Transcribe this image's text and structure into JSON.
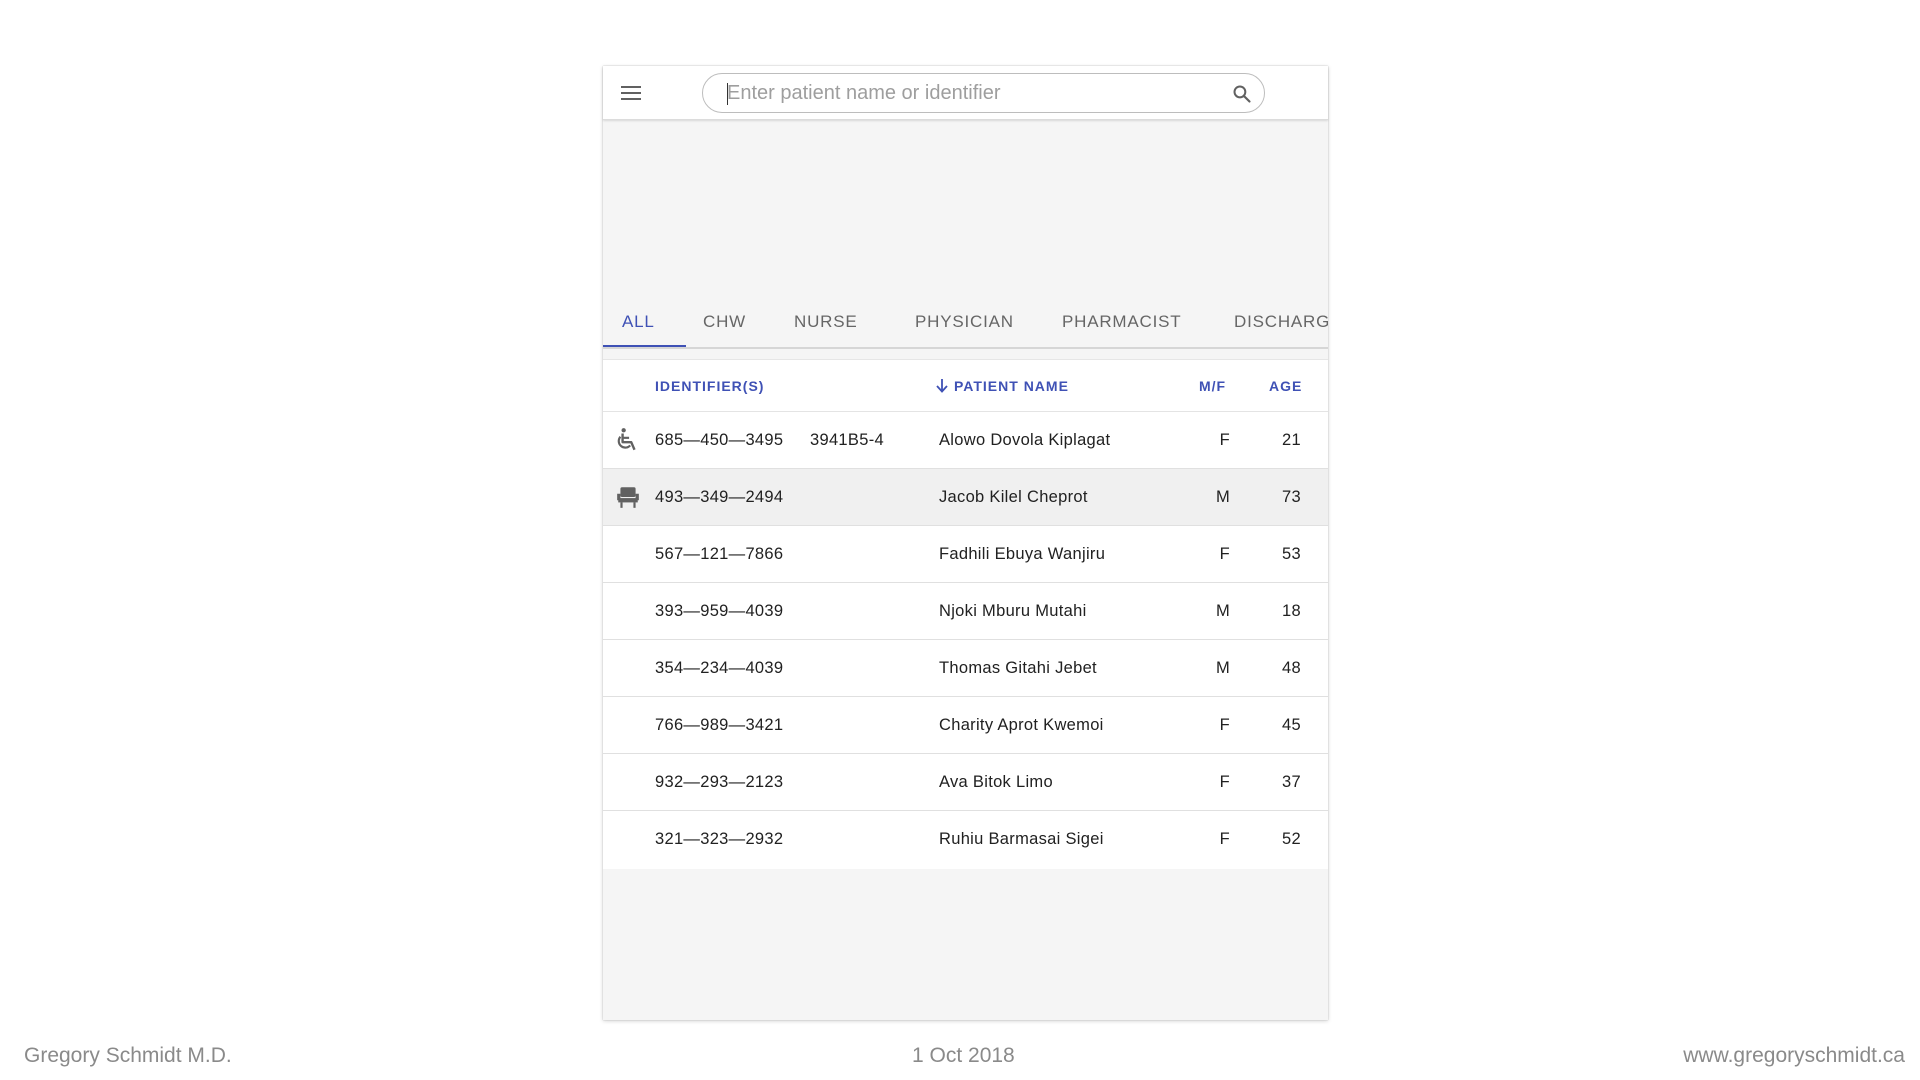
{
  "search": {
    "placeholder": "Enter patient name or identifier"
  },
  "tabs": [
    {
      "label": "ALL",
      "active": true
    },
    {
      "label": "CHW",
      "active": false
    },
    {
      "label": "NURSE",
      "active": false
    },
    {
      "label": "PHYSICIAN",
      "active": false
    },
    {
      "label": "PHARMACIST",
      "active": false
    },
    {
      "label": "DISCHARG",
      "active": false
    }
  ],
  "table": {
    "headers": {
      "identifiers": "IDENTIFIER(S)",
      "patient_name": "PATIENT NAME",
      "sex": "M/F",
      "age": "AGE"
    },
    "sort_icon": "arrow-downward-icon",
    "rows": [
      {
        "icon": "wheelchair-icon",
        "id": "685—450—3495",
        "id2": "3941B5-4",
        "name": "Alowo Dovola Kiplagat",
        "sex": "F",
        "age": "21"
      },
      {
        "icon": "waiting-chair-icon",
        "id": "493—349—2494",
        "id2": "",
        "name": "Jacob Kilel Cheprot",
        "sex": "M",
        "age": "73"
      },
      {
        "icon": "",
        "id": "567—121—7866",
        "id2": "",
        "name": "Fadhili Ebuya Wanjiru",
        "sex": "F",
        "age": "53"
      },
      {
        "icon": "",
        "id": "393—959—4039",
        "id2": "",
        "name": "Njoki Mburu Mutahi",
        "sex": "M",
        "age": "18"
      },
      {
        "icon": "",
        "id": "354—234—4039",
        "id2": "",
        "name": "Thomas Gitahi Jebet",
        "sex": "M",
        "age": "48"
      },
      {
        "icon": "",
        "id": "766—989—3421",
        "id2": "",
        "name": "Charity Aprot Kwemoi",
        "sex": "F",
        "age": "45"
      },
      {
        "icon": "",
        "id": "932—293—2123",
        "id2": "",
        "name": "Ava Bitok Limo",
        "sex": "F",
        "age": "37"
      },
      {
        "icon": "",
        "id": "321—323—2932",
        "id2": "",
        "name": "Ruhiu Barmasai Sigei",
        "sex": "F",
        "age": "52"
      }
    ]
  },
  "footer": {
    "author": "Gregory Schmidt M.D.",
    "date": "1 Oct 2018",
    "website": "www.gregoryschmidt.ca"
  },
  "colors": {
    "accent": "#3f51b5",
    "text": "#212121",
    "muted": "#8a8a8a"
  }
}
